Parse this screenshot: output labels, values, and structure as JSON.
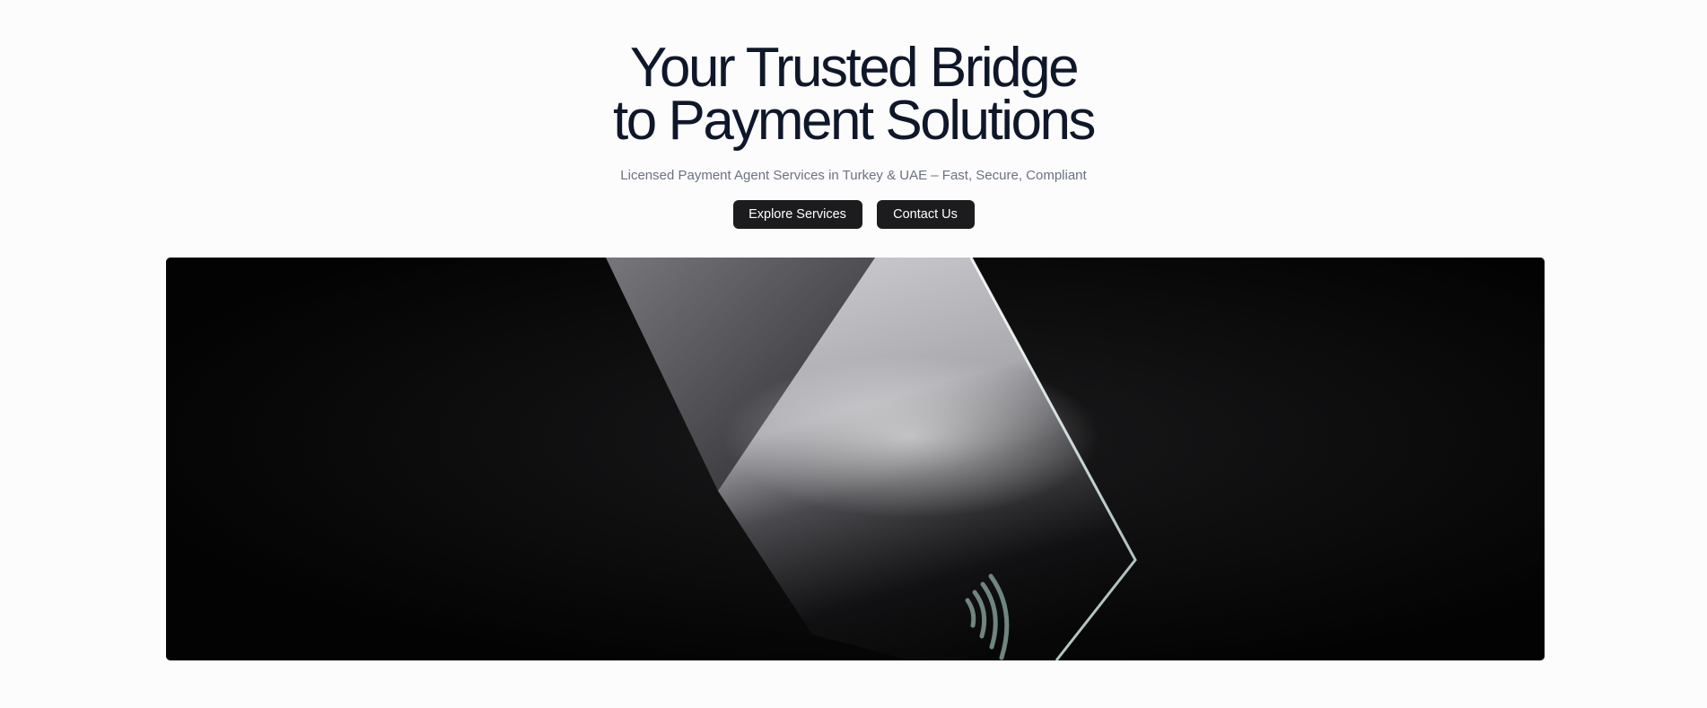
{
  "hero": {
    "title_line1": "Your Trusted Bridge",
    "title_line2": "to Payment Solutions",
    "subtitle": "Licensed Payment Agent Services in Turkey & UAE – Fast, Secure, Compliant"
  },
  "actions": {
    "explore_label": "Explore Services",
    "contact_label": "Contact Us"
  },
  "media": {
    "icon": "contactless-payment-icon",
    "subject": "card-image"
  }
}
